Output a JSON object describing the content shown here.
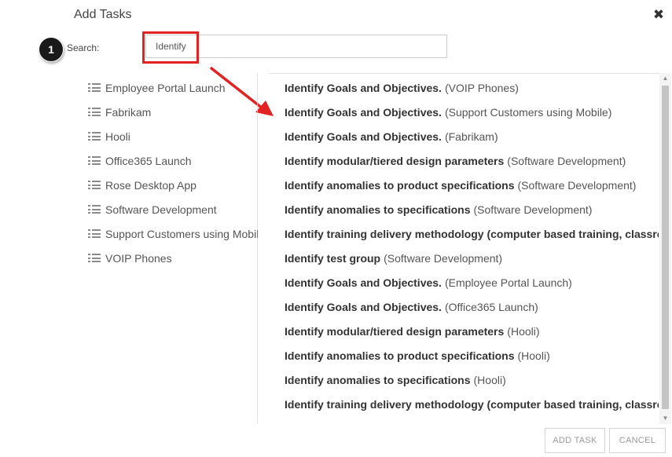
{
  "dialog": {
    "title": "Add Tasks",
    "close_icon": "close-icon"
  },
  "annotation": {
    "step_number": "1",
    "highlight_color": "#e32222"
  },
  "search": {
    "label": "Search:",
    "value": "Identify"
  },
  "projects": [
    {
      "label": "Employee Portal Launch",
      "icon": "list-icon"
    },
    {
      "label": "Fabrikam",
      "icon": "list-icon"
    },
    {
      "label": "Hooli",
      "icon": "list-icon"
    },
    {
      "label": "Office365 Launch",
      "icon": "list-icon"
    },
    {
      "label": "Rose Desktop App",
      "icon": "list-icon"
    },
    {
      "label": "Software Development",
      "icon": "list-icon"
    },
    {
      "label": "Support Customers using Mobile",
      "icon": "list-icon"
    },
    {
      "label": "VOIP Phones",
      "icon": "list-icon"
    }
  ],
  "tasks": [
    {
      "name": "Identify Goals and Objectives.",
      "project": "(VOIP Phones)"
    },
    {
      "name": "Identify Goals and Objectives.",
      "project": "(Support Customers using Mobile)"
    },
    {
      "name": "Identify Goals and Objectives.",
      "project": "(Fabrikam)"
    },
    {
      "name": "Identify modular/tiered design parameters",
      "project": "(Software Development)"
    },
    {
      "name": "Identify anomalies to product specifications",
      "project": "(Software Development)"
    },
    {
      "name": "Identify anomalies to specifications",
      "project": "(Software Development)"
    },
    {
      "name": "Identify training delivery methodology (computer based training, classroo",
      "project": ""
    },
    {
      "name": "Identify test group",
      "project": "(Software Development)"
    },
    {
      "name": "Identify Goals and Objectives.",
      "project": "(Employee Portal Launch)"
    },
    {
      "name": "Identify Goals and Objectives.",
      "project": "(Office365 Launch)"
    },
    {
      "name": "Identify modular/tiered design parameters",
      "project": "(Hooli)"
    },
    {
      "name": "Identify anomalies to product specifications",
      "project": "(Hooli)"
    },
    {
      "name": "Identify anomalies to specifications",
      "project": "(Hooli)"
    },
    {
      "name": "Identify training delivery methodology (computer based training, classroo",
      "project": ""
    }
  ],
  "footer": {
    "add_task_label": "ADD TASK",
    "cancel_label": "CANCEL"
  }
}
